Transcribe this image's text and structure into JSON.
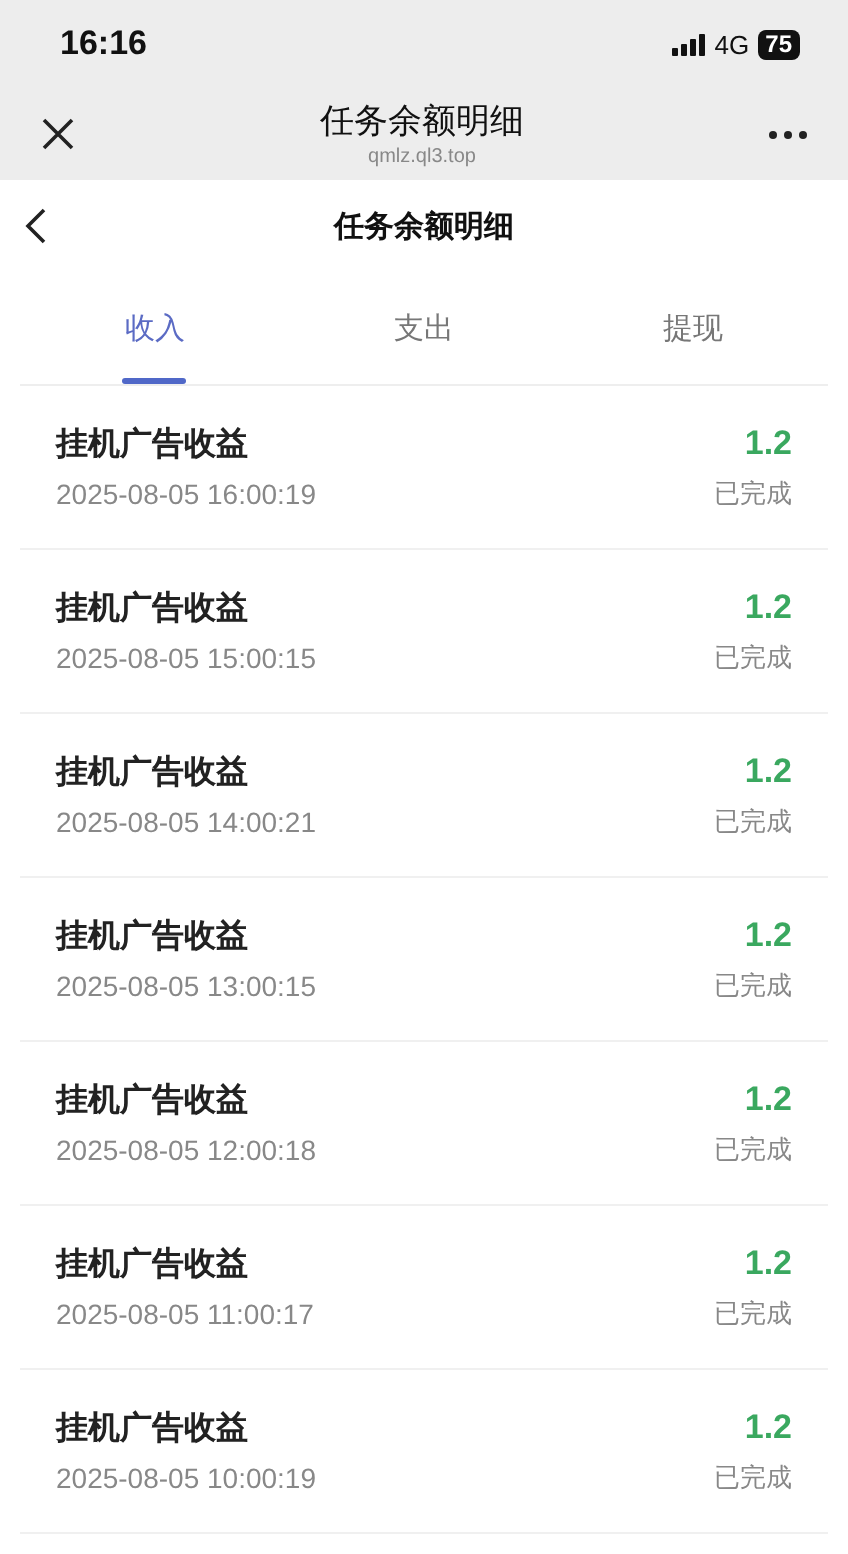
{
  "status_bar": {
    "time": "16:16",
    "network": "4G",
    "battery": "75"
  },
  "browser_bar": {
    "title": "任务余额明细",
    "url": "qmlz.ql3.top"
  },
  "page_header": {
    "title": "任务余额明细"
  },
  "tabs": [
    {
      "label": "收入",
      "selected": true
    },
    {
      "label": "支出",
      "selected": false
    },
    {
      "label": "提现",
      "selected": false
    }
  ],
  "records": [
    {
      "title": "挂机广告收益",
      "time": "2025-08-05 16:00:19",
      "amount": "1.2",
      "status": "已完成"
    },
    {
      "title": "挂机广告收益",
      "time": "2025-08-05 15:00:15",
      "amount": "1.2",
      "status": "已完成"
    },
    {
      "title": "挂机广告收益",
      "time": "2025-08-05 14:00:21",
      "amount": "1.2",
      "status": "已完成"
    },
    {
      "title": "挂机广告收益",
      "time": "2025-08-05 13:00:15",
      "amount": "1.2",
      "status": "已完成"
    },
    {
      "title": "挂机广告收益",
      "time": "2025-08-05 12:00:18",
      "amount": "1.2",
      "status": "已完成"
    },
    {
      "title": "挂机广告收益",
      "time": "2025-08-05 11:00:17",
      "amount": "1.2",
      "status": "已完成"
    },
    {
      "title": "挂机广告收益",
      "time": "2025-08-05 10:00:19",
      "amount": "1.2",
      "status": "已完成"
    }
  ]
}
